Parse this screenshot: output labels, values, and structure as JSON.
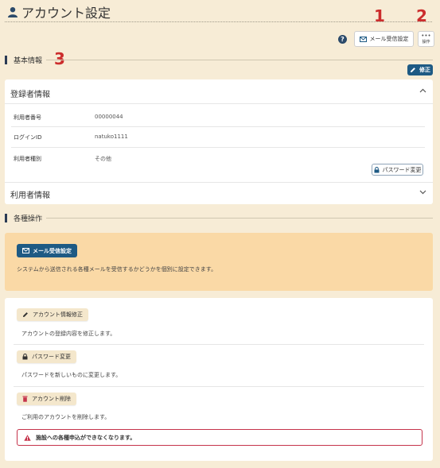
{
  "page": {
    "title": "アカウント設定"
  },
  "annotations": {
    "one": "1",
    "two": "2",
    "three": "3"
  },
  "toolbar": {
    "help": "?",
    "mail_settings_label": "メール受信設定",
    "ops_label": "操作"
  },
  "basic_info": {
    "heading": "基本情報",
    "edit_label": "修正",
    "registrant": {
      "title": "登録者情報",
      "rows": [
        {
          "label": "利用者番号",
          "value": "00000044"
        },
        {
          "label": "ログインID",
          "value": "natuko1111"
        },
        {
          "label": "利用者種別",
          "value": "その他"
        }
      ],
      "password_change_label": "パスワード変更"
    },
    "user_info": {
      "title": "利用者情報"
    }
  },
  "operations": {
    "heading": "各種操作",
    "mail": {
      "button_label": "メール受信設定",
      "description": "システムから送信される各種メールを受信するかどうかを個別に設定できます。"
    },
    "items": [
      {
        "button_label": "アカウント情報修正",
        "description": "アカウントの登録内容を修正します。"
      },
      {
        "button_label": "パスワード変更",
        "description": "パスワードを新しいものに変更します。"
      },
      {
        "button_label": "アカウント削除",
        "description": "ご利用のアカウントを削除します。"
      }
    ],
    "warning": "施設への各種申込ができなくなります。"
  },
  "colors": {
    "background": "#f7ecd6",
    "primary": "#1e5a84",
    "notice": "#fad9a6",
    "danger": "#c5334b",
    "annotation": "#cc2d2d"
  },
  "icons": [
    "user-icon",
    "mail-icon",
    "help-icon",
    "ops-icon",
    "pencil-icon",
    "lock-icon",
    "trash-icon",
    "warning-icon",
    "chevron-up-icon",
    "chevron-down-icon"
  ]
}
